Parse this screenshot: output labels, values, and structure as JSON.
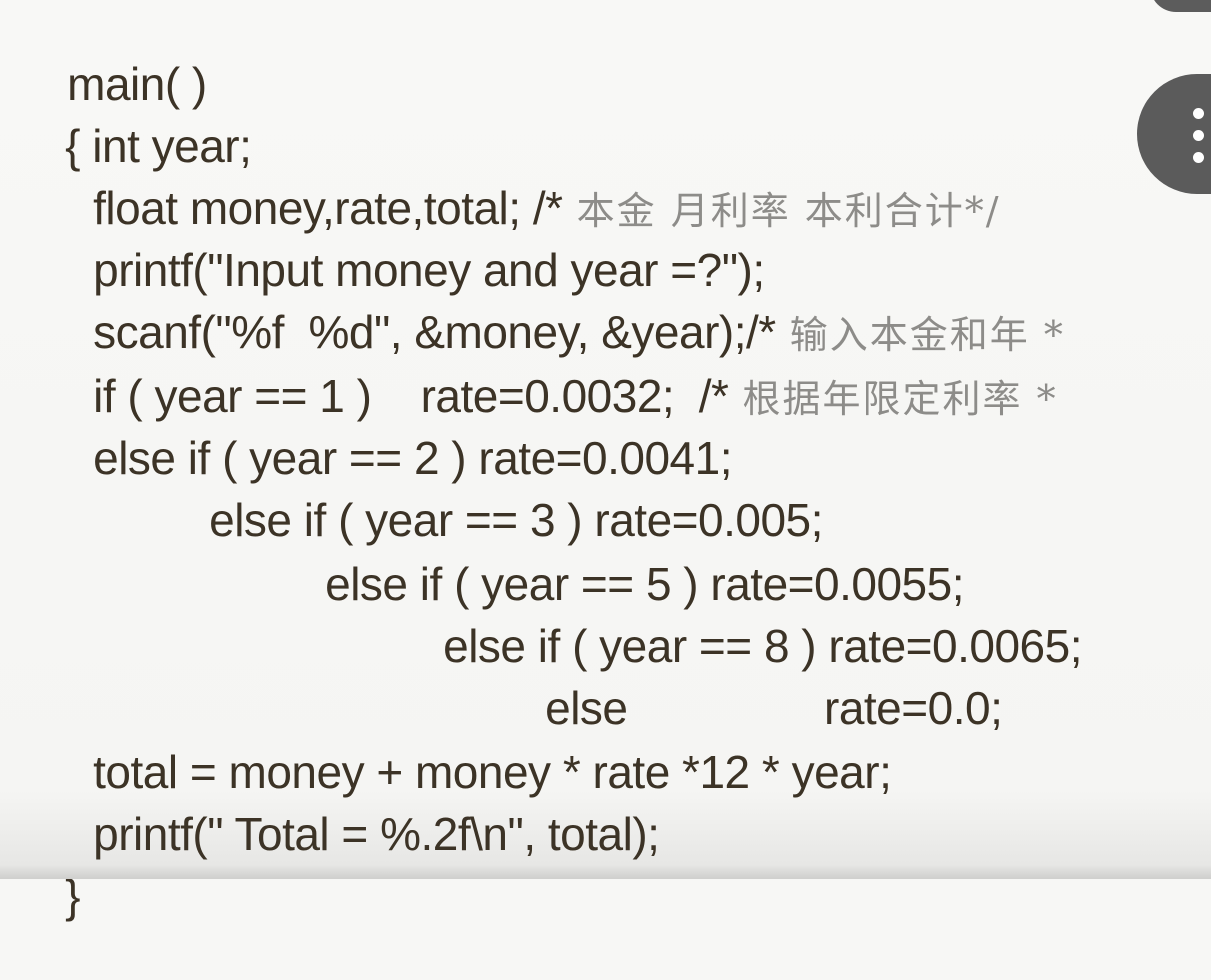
{
  "code": {
    "lines": [
      {
        "code": "main( )",
        "comment": ""
      },
      {
        "code": "{ int year;",
        "comment": ""
      },
      {
        "code": "float money,rate,total; /*",
        "comment": " 本金 月利率 本利合计*/"
      },
      {
        "code": "printf(\"Input money and year =?\");",
        "comment": ""
      },
      {
        "code": "scanf(\"%f  %d\", &money, &year);/*",
        "comment": " 输入本金和年 *"
      },
      {
        "code": "if ( year == 1 )    rate=0.0032;  /*",
        "comment": " 根据年限定利率 *"
      },
      {
        "code": "else if ( year == 2 ) rate=0.0041;",
        "comment": ""
      },
      {
        "code": "else if ( year == 3 ) rate=0.005;",
        "comment": ""
      },
      {
        "code": "else if ( year == 5 ) rate=0.0055;",
        "comment": ""
      },
      {
        "code": "else if ( year == 8 ) rate=0.0065;",
        "comment": ""
      },
      {
        "code": "else                rate=0.0;",
        "comment": ""
      },
      {
        "code": "total = money + money * rate *12 * year;",
        "comment": ""
      },
      {
        "code": "printf(\" Total = %.2f\\n\", total);",
        "comment": ""
      },
      {
        "code": "}",
        "comment": ""
      }
    ]
  },
  "overlay": {
    "more_button_icon": "vertical-ellipsis-icon"
  }
}
